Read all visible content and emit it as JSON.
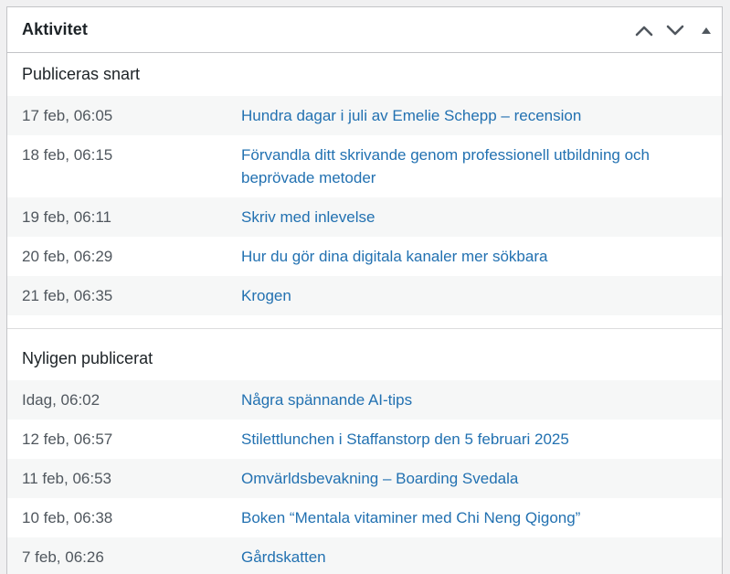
{
  "widget": {
    "title": "Aktivitet"
  },
  "sections": {
    "upcoming": {
      "title": "Publiceras snart",
      "items": [
        {
          "date": "17 feb, 06:05",
          "title": "Hundra dagar i juli av Emelie Schepp – recension"
        },
        {
          "date": "18 feb, 06:15",
          "title": "Förvandla ditt skrivande genom professionell utbildning och beprövade metoder"
        },
        {
          "date": "19 feb, 06:11",
          "title": "Skriv med inlevelse"
        },
        {
          "date": "20 feb, 06:29",
          "title": "Hur du gör dina digitala kanaler mer sökbara"
        },
        {
          "date": "21 feb, 06:35",
          "title": "Krogen"
        }
      ]
    },
    "recent": {
      "title": "Nyligen publicerat",
      "items": [
        {
          "date": "Idag, 06:02",
          "title": "Några spännande AI-tips"
        },
        {
          "date": "12 feb, 06:57",
          "title": "Stilettlunchen i Staffanstorp den 5 februari 2025"
        },
        {
          "date": "11 feb, 06:53",
          "title": "Omvärldsbevakning – Boarding Svedala"
        },
        {
          "date": "10 feb, 06:38",
          "title": "Boken “Mentala vitaminer med Chi Neng Qigong”"
        },
        {
          "date": "7 feb, 06:26",
          "title": "Gårdskatten"
        }
      ]
    }
  },
  "colors": {
    "link": "#2271b1",
    "alt_row": "#f6f7f7",
    "border": "#c3c4c7"
  }
}
